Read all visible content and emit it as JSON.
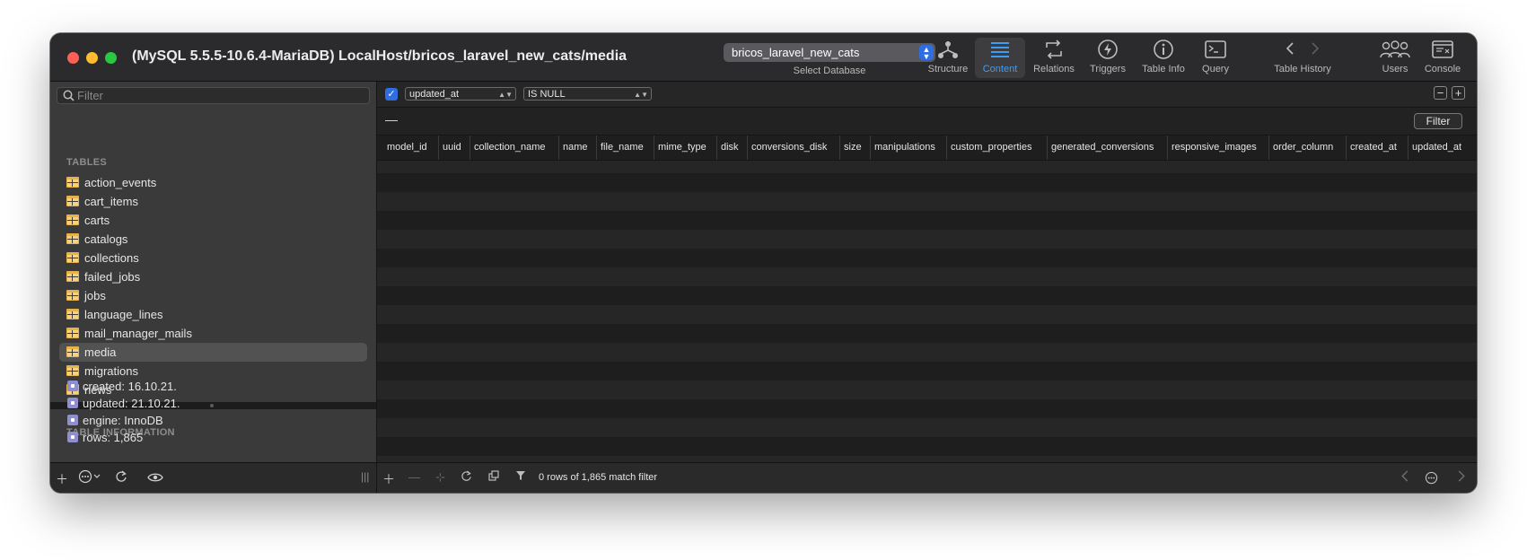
{
  "window": {
    "title": "(MySQL 5.5.5-10.6.4-MariaDB) LocalHost/bricos_laravel_new_cats/media"
  },
  "toolbar": {
    "database_value": "bricos_laravel_new_cats",
    "database_caption": "Select Database",
    "tools": [
      {
        "label": "Structure",
        "icon": "structure-icon"
      },
      {
        "label": "Content",
        "icon": "content-icon",
        "active": true
      },
      {
        "label": "Relations",
        "icon": "relations-icon"
      },
      {
        "label": "Triggers",
        "icon": "triggers-icon"
      },
      {
        "label": "Table Info",
        "icon": "info-icon"
      },
      {
        "label": "Query",
        "icon": "query-icon"
      }
    ],
    "history_label": "Table History",
    "users_label": "Users",
    "console_label": "Console"
  },
  "sidebar": {
    "filter_placeholder": "Filter",
    "tables_header": "TABLES",
    "tables": [
      {
        "name": "action_events"
      },
      {
        "name": "cart_items"
      },
      {
        "name": "carts"
      },
      {
        "name": "catalogs"
      },
      {
        "name": "collections"
      },
      {
        "name": "failed_jobs"
      },
      {
        "name": "jobs"
      },
      {
        "name": "language_lines"
      },
      {
        "name": "mail_manager_mails"
      },
      {
        "name": "media",
        "selected": true
      },
      {
        "name": "migrations"
      },
      {
        "name": "news"
      }
    ],
    "info_header": "TABLE INFORMATION",
    "info": [
      "created: 16.10.21.",
      "updated: 21.10.21.",
      "engine: InnoDB",
      "rows: 1,865"
    ]
  },
  "filter": {
    "enabled": true,
    "field": "updated_at",
    "operator": "IS NULL",
    "query_dash": "—",
    "button_label": "Filter"
  },
  "grid": {
    "columns": [
      "model_id",
      "uuid",
      "collection_name",
      "name",
      "file_name",
      "mime_type",
      "disk",
      "conversions_disk",
      "size",
      "manipulations",
      "custom_properties",
      "generated_conversions",
      "responsive_images",
      "order_column",
      "created_at",
      "updated_at"
    ],
    "rows": []
  },
  "status": {
    "row_count": "0 rows of 1,865 match filter"
  },
  "colors": {
    "accent": "#2f6de1",
    "active_tab": "#3f9cf4",
    "table_icon": "#e6b34a"
  }
}
